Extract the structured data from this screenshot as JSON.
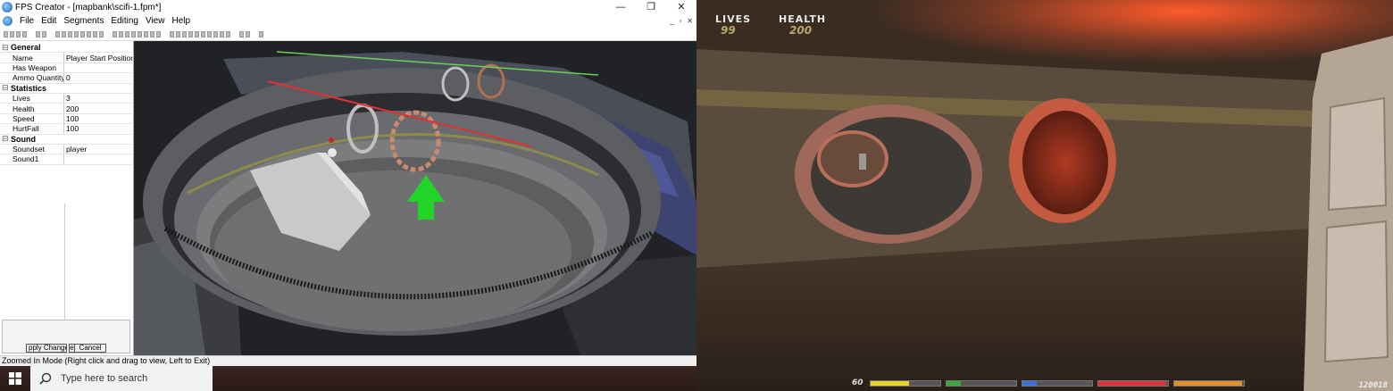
{
  "editor": {
    "title": "FPS Creator - [mapbank\\scifi-1.fpm*]",
    "window_controls": [
      "—",
      "❐",
      "✕"
    ],
    "menu": [
      "File",
      "Edit",
      "Segments",
      "Editing",
      "View",
      "Help"
    ],
    "mdi_controls": [
      "_",
      "▫",
      "✕"
    ],
    "properties": [
      {
        "type": "category",
        "label": "General",
        "toggle": "⊟"
      },
      {
        "type": "prop",
        "key": "Name",
        "value": "Player Start Position"
      },
      {
        "type": "prop",
        "key": "Has Weapon",
        "value": ""
      },
      {
        "type": "prop",
        "key": "Ammo Quantity",
        "value": "0"
      },
      {
        "type": "category",
        "label": "Statistics",
        "toggle": "⊟"
      },
      {
        "type": "prop",
        "key": "Lives",
        "value": "3"
      },
      {
        "type": "prop",
        "key": "Health",
        "value": "200"
      },
      {
        "type": "prop",
        "key": "Speed",
        "value": "100"
      },
      {
        "type": "prop",
        "key": "HurtFall",
        "value": "100"
      },
      {
        "type": "category",
        "label": "Sound",
        "toggle": "⊟"
      },
      {
        "type": "prop",
        "key": "Soundset",
        "value": "player"
      },
      {
        "type": "prop",
        "key": "Sound1",
        "value": ""
      }
    ],
    "apply_label": "pply Change",
    "apply_tail": "e",
    "cancel_label": "Cancel",
    "status": "Zoomed In Mode (Right click and drag to view, Left to Exit)"
  },
  "taskbar": {
    "search_placeholder": "Type here to search"
  },
  "hud": {
    "lives_label": "LIVES",
    "lives_value": "99",
    "health_label": "HEALTH",
    "health_value": "200",
    "ammo": "60",
    "score": "120018",
    "bars": [
      {
        "color": "#e6d22a",
        "fill": 0.55
      },
      {
        "color": "#3fa53f",
        "fill": 0.2
      },
      {
        "color": "#3b6fd8",
        "fill": 0.2
      },
      {
        "color": "#d9333a",
        "fill": 0.98
      },
      {
        "color": "#e0902e",
        "fill": 0.98
      }
    ]
  }
}
